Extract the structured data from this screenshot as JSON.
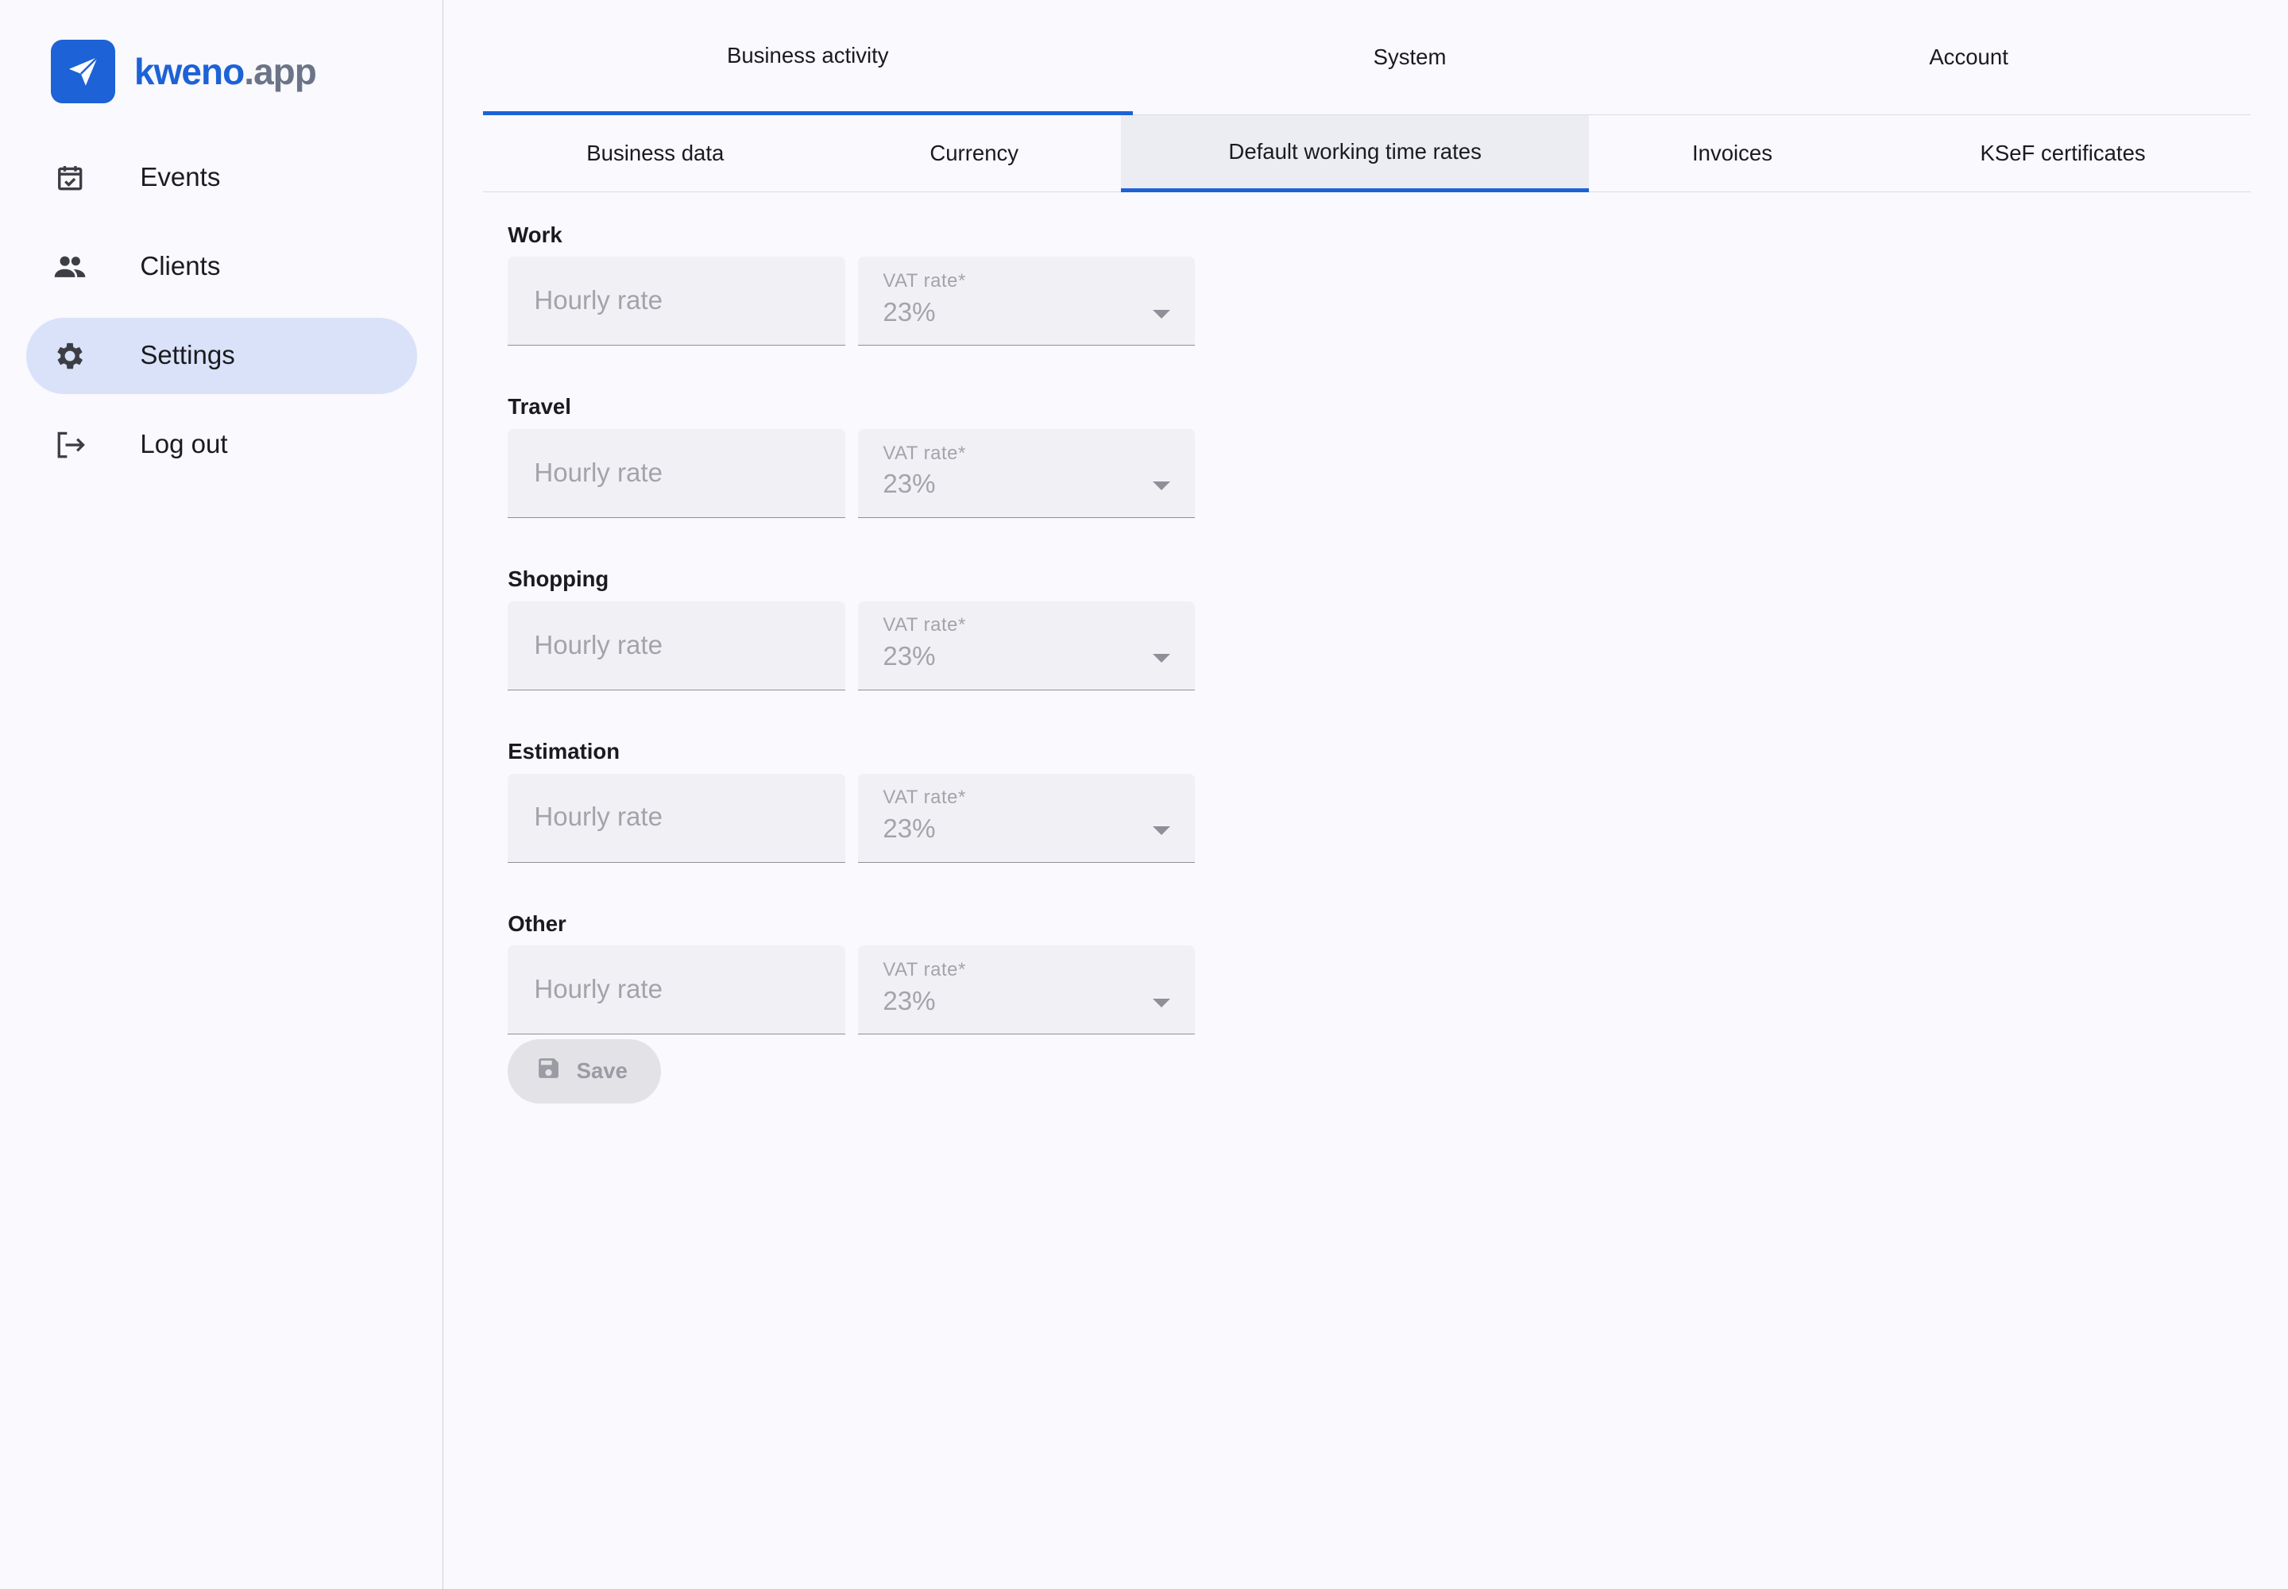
{
  "brand": {
    "name_primary": "kweno",
    "name_secondary": ".app",
    "color": "#1d62d6"
  },
  "sidebar": {
    "items": [
      {
        "label": "Events",
        "icon": "calendar-check-icon",
        "active": false
      },
      {
        "label": "Clients",
        "icon": "people-icon",
        "active": false
      },
      {
        "label": "Settings",
        "icon": "gear-icon",
        "active": true
      },
      {
        "label": "Log out",
        "icon": "logout-icon",
        "active": false
      }
    ]
  },
  "tabs": {
    "top": [
      {
        "label": "Business activity",
        "active": true
      },
      {
        "label": "System",
        "active": false
      },
      {
        "label": "Account",
        "active": false
      }
    ],
    "sub": [
      {
        "label": "Business data",
        "active": false
      },
      {
        "label": "Currency",
        "active": false
      },
      {
        "label": "Default working time rates",
        "active": true
      },
      {
        "label": "Invoices",
        "active": false
      },
      {
        "label": "KSeF certificates",
        "active": false
      }
    ]
  },
  "form": {
    "groups": [
      {
        "title": "Work",
        "rate_placeholder": "Hourly rate",
        "rate_value": "",
        "vat_label": "VAT rate*",
        "vat_value": "23%"
      },
      {
        "title": "Travel",
        "rate_placeholder": "Hourly rate",
        "rate_value": "",
        "vat_label": "VAT rate*",
        "vat_value": "23%"
      },
      {
        "title": "Shopping",
        "rate_placeholder": "Hourly rate",
        "rate_value": "",
        "vat_label": "VAT rate*",
        "vat_value": "23%"
      },
      {
        "title": "Estimation",
        "rate_placeholder": "Hourly rate",
        "rate_value": "",
        "vat_label": "VAT rate*",
        "vat_value": "23%"
      },
      {
        "title": "Other",
        "rate_placeholder": "Hourly rate",
        "rate_value": "",
        "vat_label": "VAT rate*",
        "vat_value": "23%"
      }
    ],
    "save_label": "Save",
    "save_icon": "floppy-disk-icon"
  }
}
